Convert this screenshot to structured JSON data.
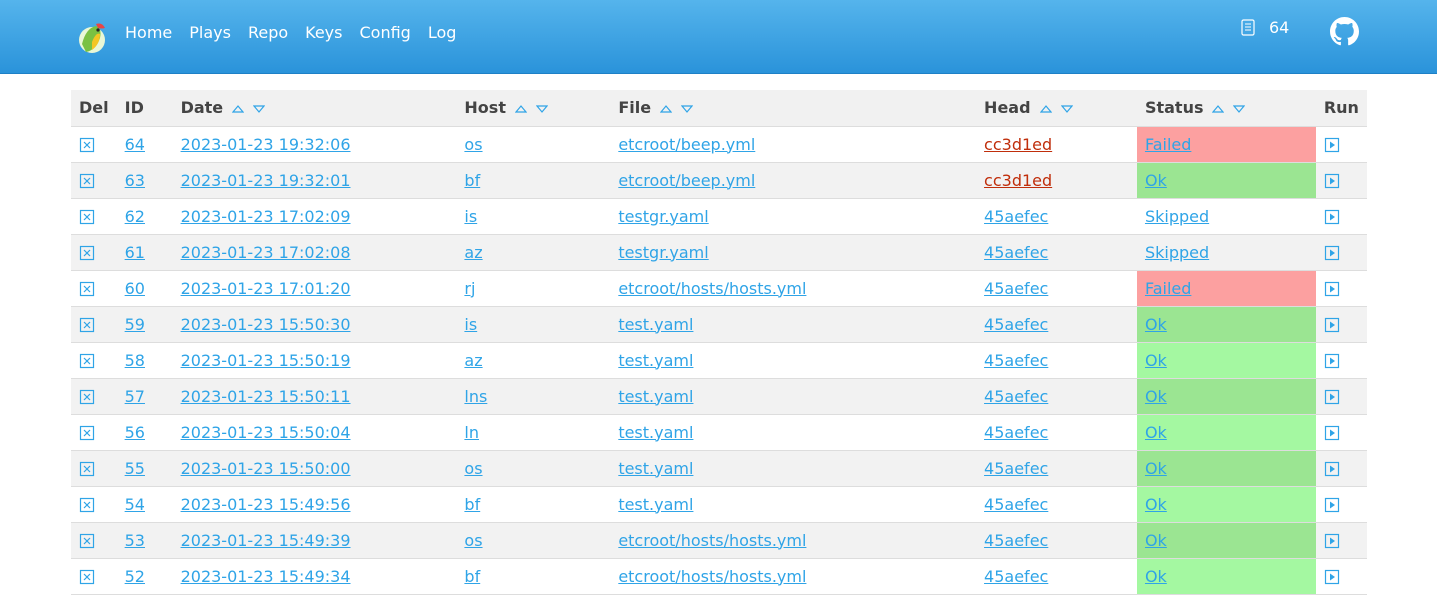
{
  "nav": {
    "items": [
      {
        "label": "Home"
      },
      {
        "label": "Plays"
      },
      {
        "label": "Repo"
      },
      {
        "label": "Keys"
      },
      {
        "label": "Config"
      },
      {
        "label": "Log"
      }
    ],
    "count": "64",
    "icons": {
      "logo": "parrot-logo-icon",
      "counter": "document-list-icon",
      "github": "github-icon"
    }
  },
  "table": {
    "headers": {
      "del": "Del",
      "id": "ID",
      "date": "Date",
      "host": "Host",
      "file": "File",
      "head": "Head",
      "status": "Status",
      "run": "Run"
    },
    "icons": {
      "delete": "close-square-icon",
      "run": "play-square-icon",
      "sort_up": "sort-asc-icon",
      "sort_down": "sort-desc-icon"
    },
    "colors": {
      "link": "#2fa4e7",
      "head_dirty": "#c02e0b",
      "failed_bg": "#fca0a0",
      "ok_bg": "#9be592",
      "ok_bg_alt": "#a4f8a1"
    },
    "rows": [
      {
        "id": "64",
        "date": "2023-01-23 19:32:06",
        "host": "os",
        "file": "etcroot/beep.yml",
        "head": "cc3d1ed",
        "status": "Failed"
      },
      {
        "id": "63",
        "date": "2023-01-23 19:32:01",
        "host": "bf",
        "file": "etcroot/beep.yml",
        "head": "cc3d1ed",
        "status": "Ok"
      },
      {
        "id": "62",
        "date": "2023-01-23 17:02:09",
        "host": "is",
        "file": "testgr.yaml",
        "head": "45aefec",
        "status": "Skipped"
      },
      {
        "id": "61",
        "date": "2023-01-23 17:02:08",
        "host": "az",
        "file": "testgr.yaml",
        "head": "45aefec",
        "status": "Skipped"
      },
      {
        "id": "60",
        "date": "2023-01-23 17:01:20",
        "host": "rj",
        "file": "etcroot/hosts/hosts.yml",
        "head": "45aefec",
        "status": "Failed"
      },
      {
        "id": "59",
        "date": "2023-01-23 15:50:30",
        "host": "is",
        "file": "test.yaml",
        "head": "45aefec",
        "status": "Ok"
      },
      {
        "id": "58",
        "date": "2023-01-23 15:50:19",
        "host": "az",
        "file": "test.yaml",
        "head": "45aefec",
        "status": "Ok"
      },
      {
        "id": "57",
        "date": "2023-01-23 15:50:11",
        "host": "lns",
        "file": "test.yaml",
        "head": "45aefec",
        "status": "Ok"
      },
      {
        "id": "56",
        "date": "2023-01-23 15:50:04",
        "host": "ln",
        "file": "test.yaml",
        "head": "45aefec",
        "status": "Ok"
      },
      {
        "id": "55",
        "date": "2023-01-23 15:50:00",
        "host": "os",
        "file": "test.yaml",
        "head": "45aefec",
        "status": "Ok"
      },
      {
        "id": "54",
        "date": "2023-01-23 15:49:56",
        "host": "bf",
        "file": "test.yaml",
        "head": "45aefec",
        "status": "Ok"
      },
      {
        "id": "53",
        "date": "2023-01-23 15:49:39",
        "host": "os",
        "file": "etcroot/hosts/hosts.yml",
        "head": "45aefec",
        "status": "Ok"
      },
      {
        "id": "52",
        "date": "2023-01-23 15:49:34",
        "host": "bf",
        "file": "etcroot/hosts/hosts.yml",
        "head": "45aefec",
        "status": "Ok"
      }
    ]
  }
}
